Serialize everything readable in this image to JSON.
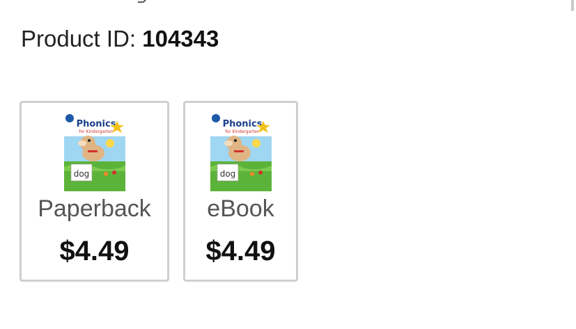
{
  "product": {
    "id_label": "Product ID:",
    "id_value": "104343"
  },
  "formats": [
    {
      "label": "Paperback",
      "price": "$4.49",
      "cover": {
        "title": "Phonics",
        "subtitle": "for Kindergarten",
        "card_word": "dog",
        "icon": "book-cover-image"
      }
    },
    {
      "label": "eBook",
      "price": "$4.49",
      "cover": {
        "title": "Phonics",
        "subtitle": "for Kindergarten",
        "card_word": "dog",
        "icon": "book-cover-image"
      }
    }
  ],
  "colors": {
    "card_border": "#cfcfcf",
    "price_text": "#111111",
    "label_text": "#555555",
    "cover_sky": "#9fd6f2",
    "cover_grass": "#5cb33a"
  }
}
